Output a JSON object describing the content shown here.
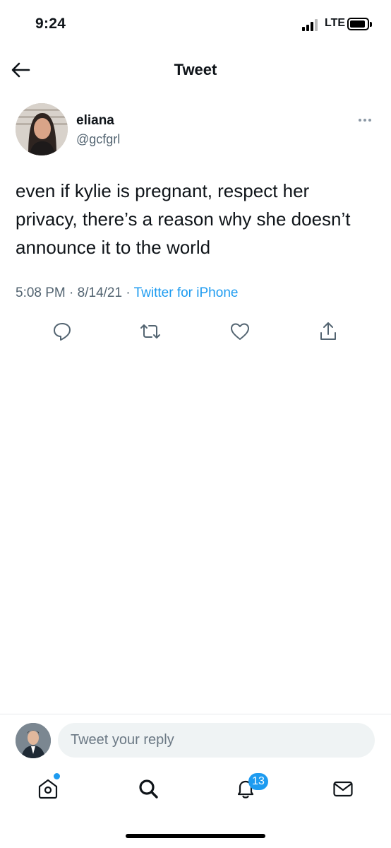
{
  "status_bar": {
    "time": "9:24",
    "network": "LTE"
  },
  "header": {
    "title": "Tweet",
    "back_icon": "arrow-left-icon"
  },
  "tweet": {
    "author_name": "eliana",
    "author_handle": "@gcfgrl",
    "text": "even if kylie is pregnant, respect her privacy, there’s a reason why she doesn’t announce it to the world",
    "time": "5:08 PM",
    "date": "8/14/21",
    "source": "Twitter for iPhone",
    "actions": [
      "reply-icon",
      "retweet-icon",
      "like-icon",
      "share-icon"
    ]
  },
  "reply": {
    "placeholder": "Tweet your reply"
  },
  "tab_bar": {
    "items": [
      "home-icon",
      "search-icon",
      "notifications-icon",
      "messages-icon"
    ],
    "notification_count": "13"
  },
  "colors": {
    "accent": "#1d9bf0",
    "secondary_text": "#536471",
    "input_bg": "#eff3f4"
  }
}
